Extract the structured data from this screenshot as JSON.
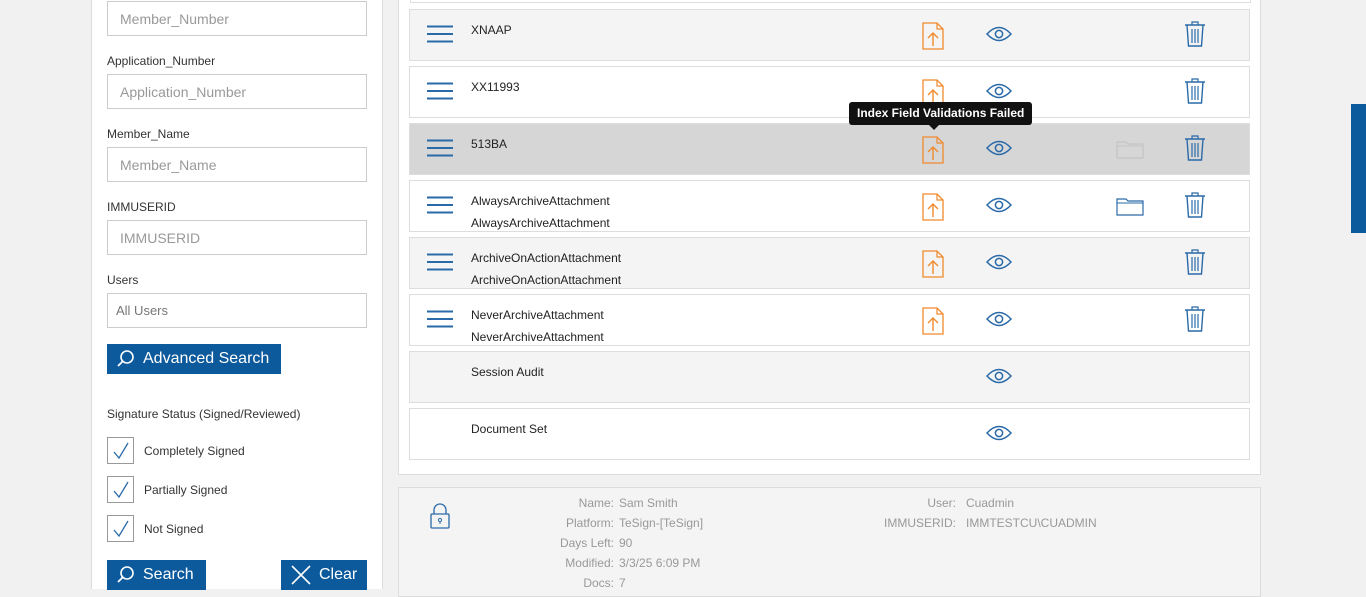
{
  "filters": {
    "member_number": {
      "placeholder": "Member_Number"
    },
    "application_number": {
      "label": "Application_Number",
      "placeholder": "Application_Number"
    },
    "member_name": {
      "label": "Member_Name",
      "placeholder": "Member_Name"
    },
    "immuserid": {
      "label": "IMMUSERID",
      "placeholder": "IMMUSERID"
    },
    "users": {
      "label": "Users",
      "value": "All Users"
    },
    "advanced_search_label": "Advanced Search",
    "signature_status_title": "Signature Status (Signed/Reviewed)",
    "signature_options": [
      {
        "label": "Completely Signed",
        "checked": true
      },
      {
        "label": "Partially Signed",
        "checked": true
      },
      {
        "label": "Not Signed",
        "checked": true
      }
    ],
    "search_label": "Search",
    "clear_label": "Clear"
  },
  "documents": [
    {
      "line1": "XNAAP",
      "line2": ""
    },
    {
      "line1": "XX11993",
      "line2": ""
    },
    {
      "line1": "513BA",
      "line2": ""
    },
    {
      "line1": "AlwaysArchiveAttachment",
      "line2": "AlwaysArchiveAttachment"
    },
    {
      "line1": "ArchiveOnActionAttachment",
      "line2": "ArchiveOnActionAttachment"
    },
    {
      "line1": "NeverArchiveAttachment",
      "line2": "NeverArchiveAttachment"
    },
    {
      "line1": "Session Audit",
      "line2": ""
    },
    {
      "line1": "Document Set",
      "line2": ""
    }
  ],
  "tooltip": "Index Field Validations Failed",
  "info": {
    "name_key": "Name:",
    "name": "Sam Smith",
    "platform_key": "Platform:",
    "platform": "TeSign-[TeSign]",
    "days_left_key": "Days Left:",
    "days_left": "90",
    "modified_key": "Modified:",
    "modified": "3/3/25 6:09 PM",
    "docs_key": "Docs:",
    "docs": "7",
    "user_key": "User:",
    "user": "Cuadmin",
    "immuserid_key": "IMMUSERID:",
    "immuserid": "IMMTESTCU\\CUADMIN"
  },
  "colors": {
    "accent": "#0c5a9c",
    "upload": "#f08a2c",
    "icon_blue": "#2a6aa8"
  }
}
